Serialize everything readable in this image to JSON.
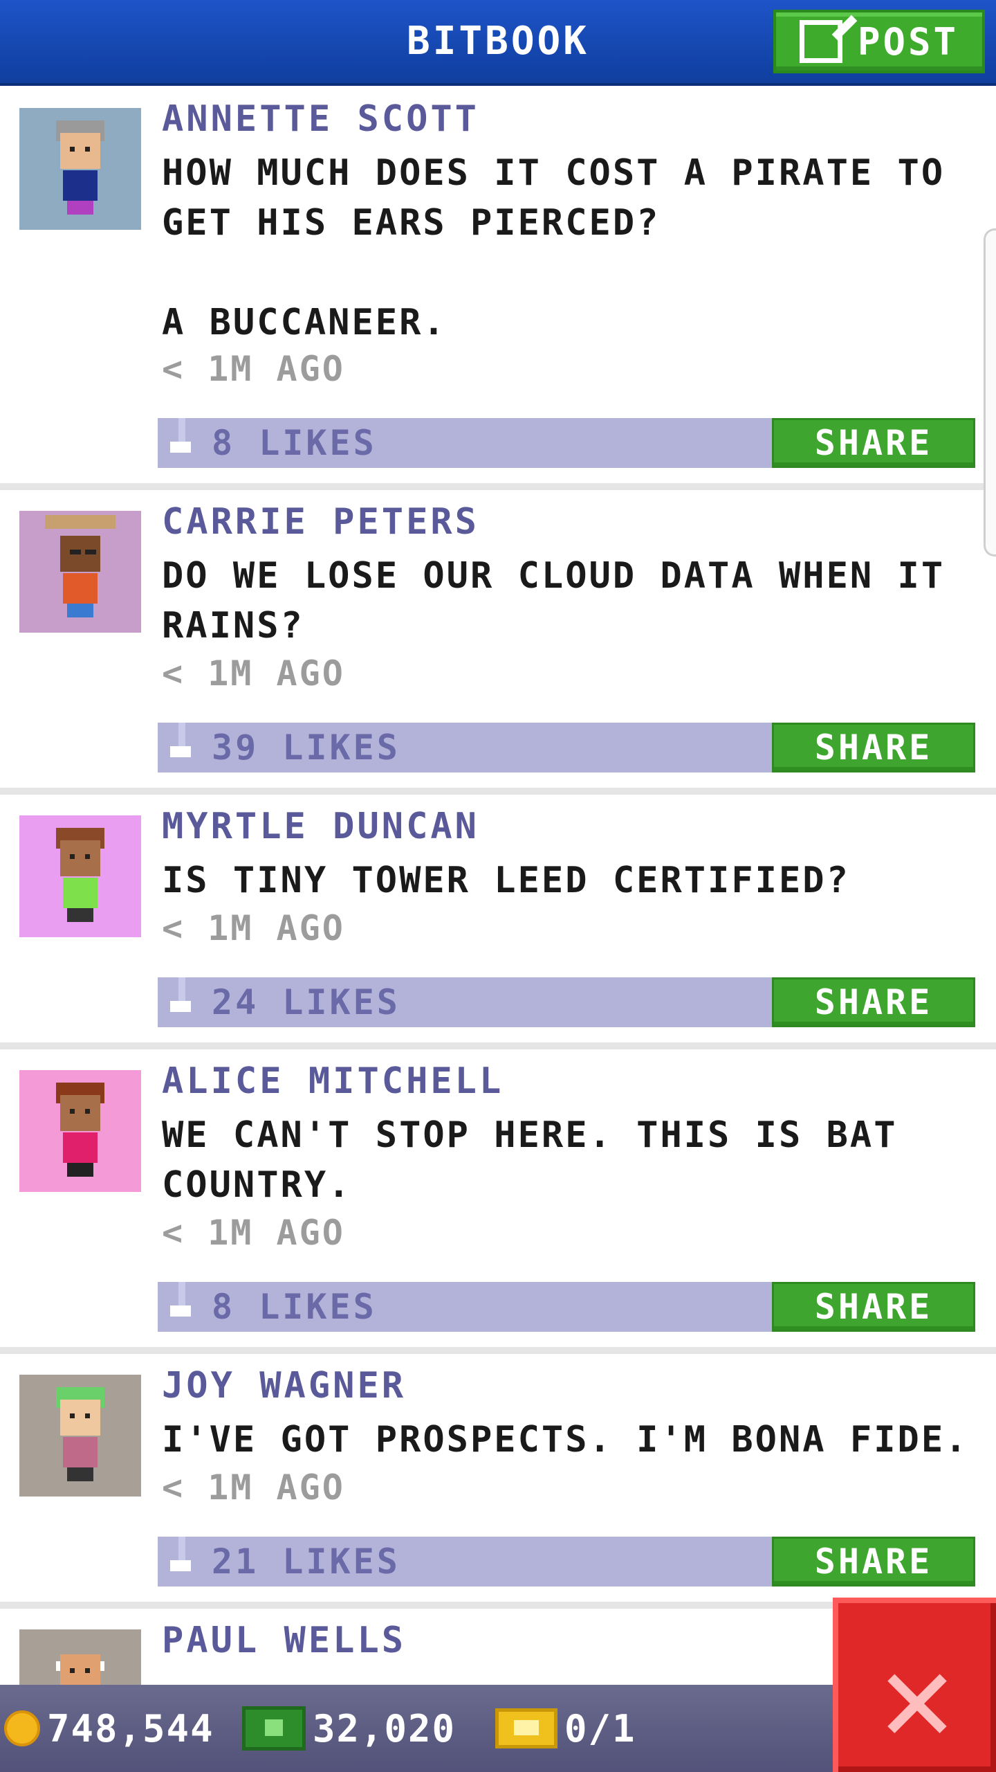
{
  "header": {
    "title": "BITBOOK",
    "post_label": "POST"
  },
  "posts": [
    {
      "name": "ANNETTE SCOTT",
      "message": "HOW MUCH DOES IT COST A PIRATE TO\nGET HIS EARS PIERCED?\n\nA BUCCANEER.",
      "time": "< 1M AGO",
      "likes": "8 LIKES",
      "share_label": "SHARE",
      "avatar_bg": "#8fabc2"
    },
    {
      "name": "CARRIE PETERS",
      "message": "DO WE LOSE OUR CLOUD DATA WHEN IT\nRAINS?",
      "time": "< 1M AGO",
      "likes": "39 LIKES",
      "share_label": "SHARE",
      "avatar_bg": "#c79ec9"
    },
    {
      "name": "MYRTLE DUNCAN",
      "message": "IS TINY TOWER LEED CERTIFIED?",
      "time": "< 1M AGO",
      "likes": "24 LIKES",
      "share_label": "SHARE",
      "avatar_bg": "#ea9ef2"
    },
    {
      "name": "ALICE MITCHELL",
      "message": "WE CAN'T STOP HERE. THIS IS BAT\nCOUNTRY.",
      "time": "< 1M AGO",
      "likes": "8 LIKES",
      "share_label": "SHARE",
      "avatar_bg": "#f49ad6"
    },
    {
      "name": "JOY WAGNER",
      "message": "I'VE GOT PROSPECTS. I'M BONA FIDE.",
      "time": "< 1M AGO",
      "likes": "21 LIKES",
      "share_label": "SHARE",
      "avatar_bg": "#a8a096"
    },
    {
      "name": "PAUL WELLS",
      "avatar_bg": "#a8a096"
    }
  ],
  "status_bar": {
    "coins": "748,544",
    "bux": "32,020",
    "tickets": "0/1"
  },
  "colors": {
    "header_blue": "#1e54c8",
    "accent_green": "#3ea52e",
    "name_purple": "#5a5a9a",
    "likebar": "#b3b3d9",
    "close_red": "#e02828"
  }
}
